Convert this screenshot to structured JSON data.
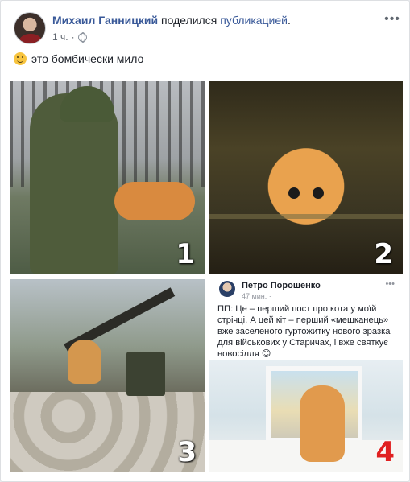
{
  "post": {
    "author": "Михаил Ганницкий",
    "action_text": " поделился ",
    "action_link": "публикацией",
    "action_end": ".",
    "time": "1 ч.",
    "separator": "·",
    "text": "это бомбически мило",
    "more_glyph": "•••"
  },
  "icons": {
    "privacy": "globe-icon",
    "emoji": "smile-icon",
    "menu": "more-icon"
  },
  "collage": {
    "tiles": [
      {
        "number": "1"
      },
      {
        "number": "2"
      },
      {
        "number": "3"
      },
      {
        "number": "4"
      }
    ],
    "shared_post": {
      "author": "Петро Порошенко",
      "time": "47 мин. · ",
      "text": "ПП: Це – перший пост про кота у моїй стрічці. А цей кіт – перший «мешканець» вже заселеного гуртожитку нового зразка для військових у Старичах, і вже святкує новосілля 😊",
      "more_glyph": "•••"
    }
  },
  "colors": {
    "link": "#385898",
    "meta": "#616770",
    "number4": "#e02020"
  }
}
